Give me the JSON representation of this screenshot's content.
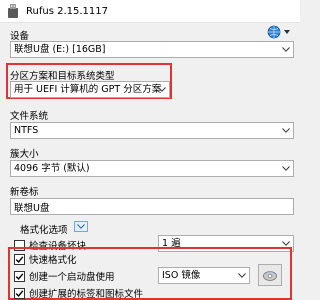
{
  "window": {
    "title": "Rufus 2.15.1117"
  },
  "device": {
    "label": "设备",
    "value": "联想U盘 (E:) [16GB]"
  },
  "partition": {
    "label": "分区方案和目标系统类型",
    "value": "用于 UEFI 计算机的 GPT 分区方案"
  },
  "filesystem": {
    "label": "文件系统",
    "value": "NTFS"
  },
  "cluster": {
    "label": "簇大小",
    "value": "4096 字节 (默认)"
  },
  "volume": {
    "label": "新卷标",
    "value": "联想U盘"
  },
  "format_options": {
    "label": "格式化选项",
    "bad_blocks": {
      "label": "检查设备坏块",
      "checked": false,
      "passes": "1 遍"
    },
    "quick_format": {
      "label": "快速格式化",
      "checked": true
    },
    "bootable": {
      "label": "创建一个启动盘使用",
      "checked": true,
      "image_type": "ISO 镜像"
    },
    "extended_label": {
      "label": "创建扩展的标签和图标文件",
      "checked": true
    }
  },
  "icons": {
    "app": "usb-drive-icon",
    "language": "globe-icon",
    "dropdown": "chevron-down-icon",
    "expand": "chevron-down-icon",
    "disc": "optical-disc-icon"
  },
  "colors": {
    "highlight_box": "#e23333",
    "window_bg": "#f0f0f0"
  }
}
